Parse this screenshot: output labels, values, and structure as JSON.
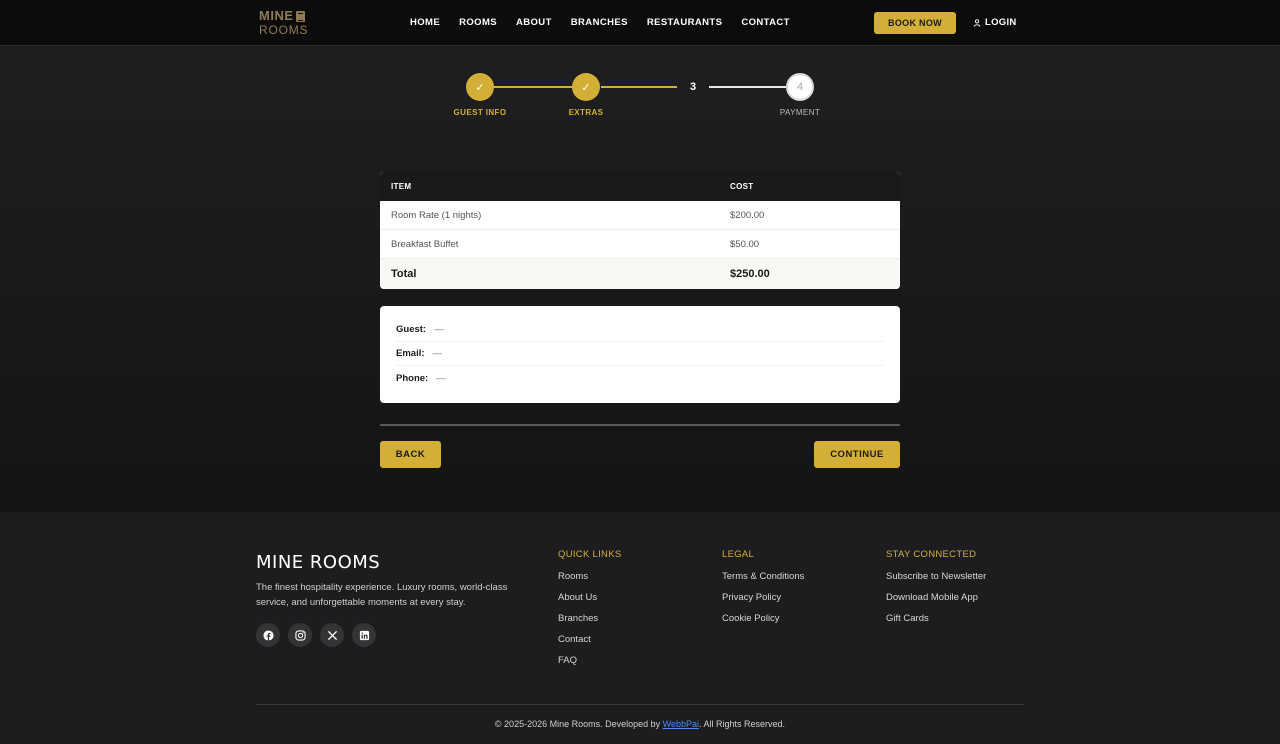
{
  "header": {
    "logo_line1": "MINE",
    "logo_line2": "ROOMS",
    "nav": [
      "HOME",
      "ROOMS",
      "ABOUT",
      "BRANCHES",
      "RESTAURANTS",
      "CONTACT"
    ],
    "book_now": "BOOK NOW",
    "login": "LOGIN"
  },
  "stepper": {
    "steps": [
      {
        "mark": "✓",
        "label": "GUEST INFO",
        "state": "done"
      },
      {
        "mark": "✓",
        "label": "EXTRAS",
        "state": "done"
      },
      {
        "mark": "3",
        "label": "",
        "state": "current"
      },
      {
        "mark": "4",
        "label": "PAYMENT",
        "state": "todo"
      }
    ],
    "accent": "#d4af37"
  },
  "cost_table": {
    "headers": [
      "ITEM",
      "COST"
    ],
    "rows": [
      {
        "item": "Room Rate (1 nights)",
        "cost": "$200.00"
      },
      {
        "item": "Breakfast Buffet",
        "cost": "$50.00"
      }
    ],
    "total_label": "Total",
    "total_value": "$250.00"
  },
  "guest": {
    "guest_label": "Guest:",
    "guest_value": "—",
    "email_label": "Email:",
    "email_value": "—",
    "phone_label": "Phone:",
    "phone_value": "—"
  },
  "actions": {
    "back": "BACK",
    "continue": "CONTINUE"
  },
  "footer": {
    "brand": "MINE ROOMS",
    "tagline": "The finest hospitality experience. Luxury rooms, world-class service, and unforgettable moments at every stay.",
    "socials": [
      "facebook-icon",
      "instagram-icon",
      "x-icon",
      "linkedin-icon"
    ],
    "quick_links": {
      "title": "QUICK LINKS",
      "items": [
        "Rooms",
        "About Us",
        "Branches",
        "Contact",
        "FAQ"
      ]
    },
    "legal": {
      "title": "LEGAL",
      "items": [
        "Terms & Conditions",
        "Privacy Policy",
        "Cookie Policy"
      ]
    },
    "stay_connected": {
      "title": "STAY CONNECTED",
      "items": [
        "Subscribe to Newsletter",
        "Download Mobile App",
        "Gift Cards"
      ]
    },
    "copyright_pre": "© 2025-2026 Mine Rooms. Developed by ",
    "copyright_link": "WebbPai",
    "copyright_post": ". All Rights Reserved."
  }
}
